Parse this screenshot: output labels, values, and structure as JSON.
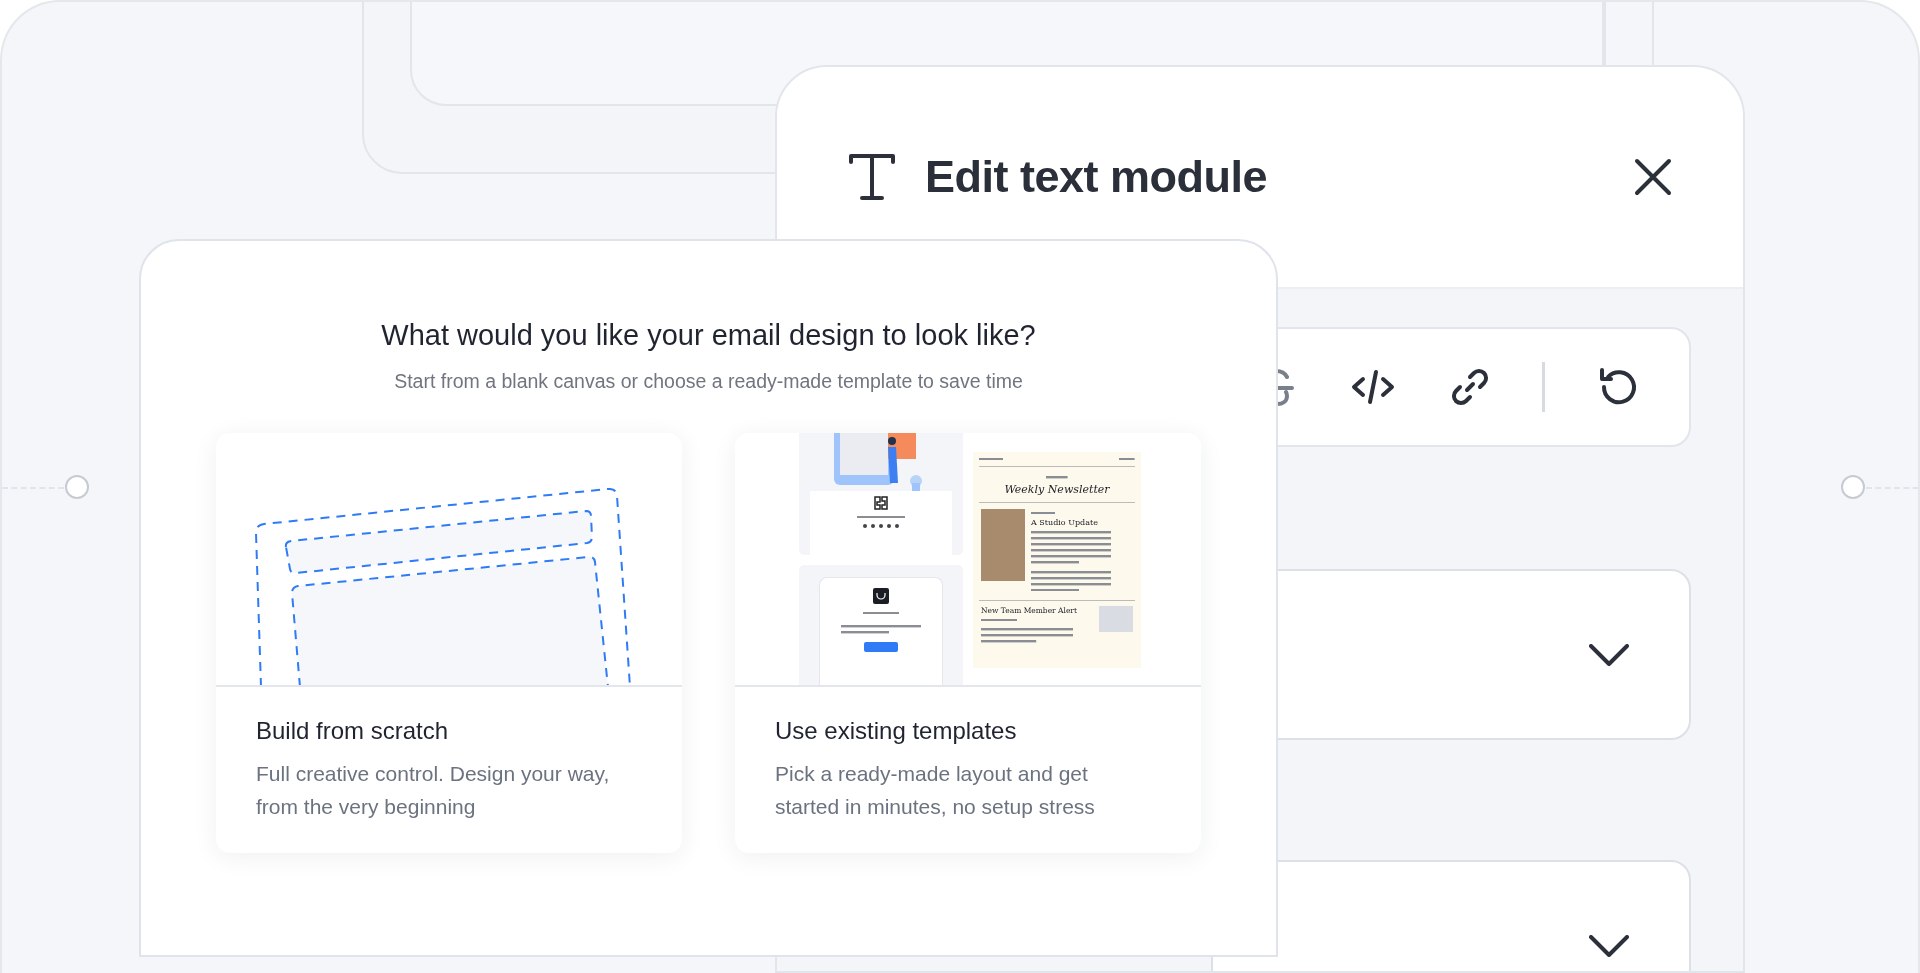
{
  "edit_panel": {
    "title": "Edit text module"
  },
  "start_modal": {
    "heading": "What would you like your email design to look like?",
    "subheading": "Start from a blank canvas or choose a ready-made template to save time",
    "options": [
      {
        "kind": "blank",
        "title": "Build from scratch",
        "description": "Full creative control. Design your way, from the very beginning"
      },
      {
        "kind": "templates",
        "title": "Use existing templates",
        "description": "Pick a ready-made layout and get started in minutes, no setup stress",
        "preview": {
          "newsletter_title": "Weekly Newsletter",
          "update_title": "A Studio Update",
          "alert_title": "New Team Member Alert"
        }
      }
    ]
  }
}
